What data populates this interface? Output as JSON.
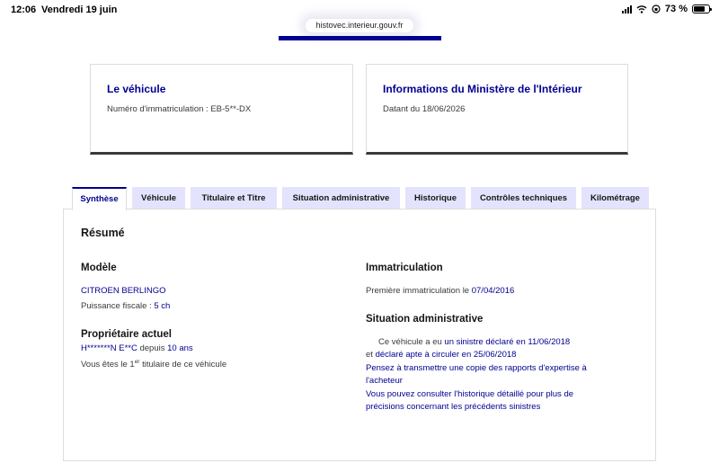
{
  "status_bar": {
    "time": "12:06",
    "date": "Vendredi 19 juin",
    "battery": "73 %",
    "battery_level": 0.73
  },
  "browser": {
    "url": "histovec.interieur.gouv.fr"
  },
  "cards": {
    "vehicle": {
      "title": "Le véhicule",
      "text": "Numéro d'immatriculation : EB-5**-DX"
    },
    "ministry": {
      "title": "Informations du Ministère de l'Intérieur",
      "text": "Datant du 18/06/2026"
    }
  },
  "tabs": [
    {
      "label": "Synthèse",
      "active": true
    },
    {
      "label": "Véhicule",
      "active": false
    },
    {
      "label": "Titulaire et Titre",
      "active": false
    },
    {
      "label": "Situation administrative",
      "active": false
    },
    {
      "label": "Historique",
      "active": false
    },
    {
      "label": "Contrôles techniques",
      "active": false
    },
    {
      "label": "Kilométrage",
      "active": false
    }
  ],
  "summary": {
    "title": "Résumé",
    "model": {
      "heading": "Modèle",
      "name": "CITROEN BERLINGO",
      "power_label": "Puissance fiscale : ",
      "power_value": "5 ch"
    },
    "owner": {
      "heading": "Propriétaire actuel",
      "name": "H*******N E**C",
      "since_label": " depuis ",
      "duration": "10 ans",
      "rank_prefix": "Vous êtes le 1",
      "rank_sup": "er",
      "rank_suffix": " titulaire de ce véhicule"
    },
    "registration": {
      "heading": "Immatriculation",
      "label": "Première immatriculation le ",
      "date": "07/04/2016"
    },
    "admin": {
      "heading": "Situation administrative",
      "l1_prefix": "Ce véhicule a eu ",
      "l1_link": "un sinistre déclaré en 11/06/2018",
      "l2_prefix": "et ",
      "l2_link": "déclaré apte à circuler en 25/06/2018",
      "l3": "Pensez à transmettre une copie des rapports d'expertise à",
      "l4": "l'acheteur",
      "l5": "Vous pouvez consulter l'historique détaillé pour plus de",
      "l6": "précisions concernant les précédents sinistres"
    }
  }
}
